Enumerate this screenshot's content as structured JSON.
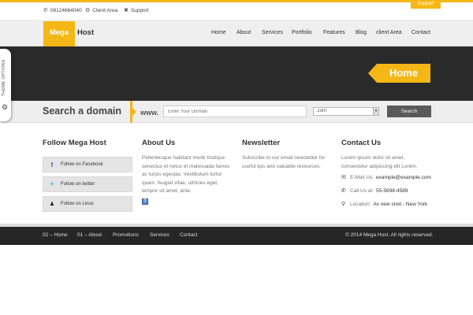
{
  "colors": {
    "accent": "#f5b716",
    "dark": "#2a2a2a",
    "header_bg": "#efefef",
    "footer_bg": "#262626"
  },
  "topbar": {
    "phone": "08124664040",
    "phone_icon": "phone-icon",
    "client_area": "Client Area",
    "client_icon": "users-icon",
    "support": "Support",
    "support_icon": "tools-icon",
    "support_tab": "Support"
  },
  "logo": {
    "part1": "Mega",
    "part2": "Host"
  },
  "nav": [
    "Home",
    "About",
    "Services",
    "Portfolio",
    "Features",
    "Blog",
    "client Area",
    "Contact"
  ],
  "hero": {
    "badge": "Home"
  },
  "theme_options": {
    "label": "THEME OPTIONS",
    "icon": "gear-icon"
  },
  "domain_search": {
    "title": "Search a domain",
    "prefix": "www.",
    "placeholder": "Enter Your Domain",
    "tld": ".com",
    "button": "Search"
  },
  "follow": {
    "title": "Follow Mega Host",
    "buttons": [
      {
        "label": "Follow on Facebook",
        "icon": "facebook-icon",
        "glyph": "f",
        "color": "#3b5998"
      },
      {
        "label": "Follow on twitter",
        "icon": "twitter-icon",
        "glyph": "🐦",
        "color": "#33aaee"
      },
      {
        "label": "Follow on Linux",
        "icon": "linux-icon",
        "glyph": "🐧",
        "color": "#222222"
      }
    ]
  },
  "about": {
    "title": "About Us",
    "lines": [
      "Pellentesque habitant morbi tristique",
      "senectus et netus et malesuada fames",
      "ac turpis egestas. Vestibulum tortor",
      "quam, feugiat vitae, ultricies eget,",
      "tempor sit amet, ante."
    ]
  },
  "newsletter": {
    "title": "Newsletter",
    "lines": [
      "Subscribe to our email newsletter for",
      "useful tips and valuable resources."
    ]
  },
  "contact": {
    "title": "Contact Us",
    "lines": [
      "Lorem ipsum dolor sit amet,",
      "consectetur adipiscing elit Lorem."
    ],
    "email_label": "E-Mail Us:",
    "email": "example@example.com",
    "call_label": "Call Us at:",
    "phone": "55-5698-4589",
    "location_label": "Location:",
    "location": "Av new stret - New York"
  },
  "footer": {
    "links": [
      "02 – Home",
      "01 – About",
      "Promotions",
      "Services",
      "Contact"
    ],
    "copyright": "© 2014 Mega Host. All rights reserved."
  }
}
